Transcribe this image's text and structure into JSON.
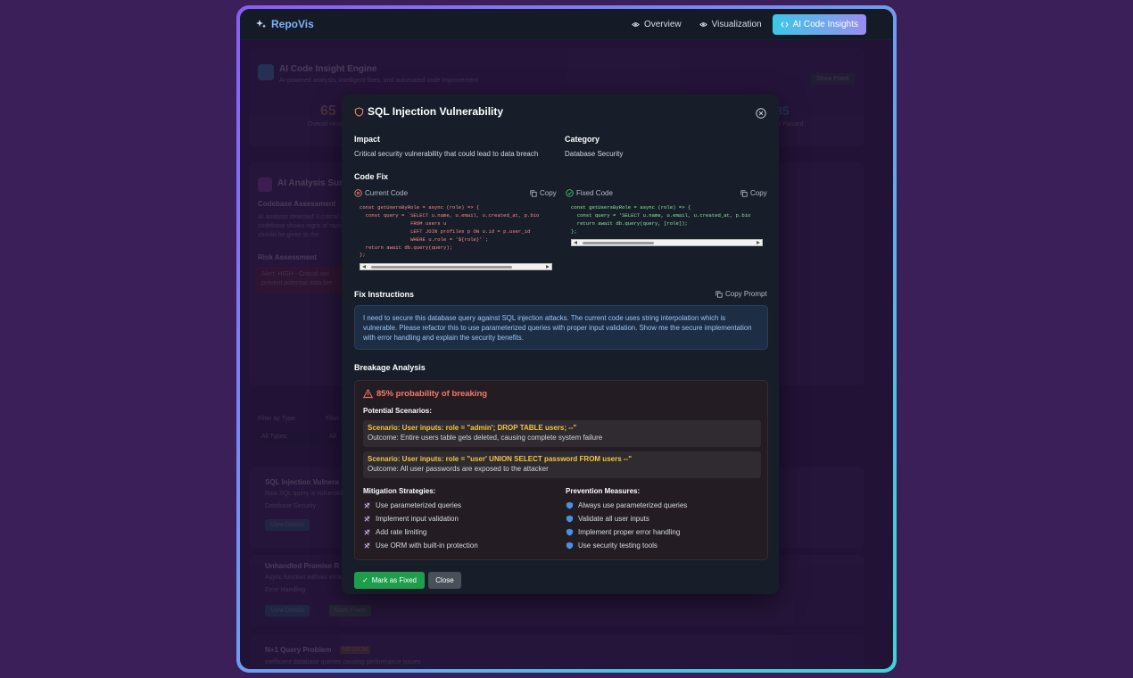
{
  "app": {
    "logo": "RepoVis"
  },
  "nav": [
    {
      "label": "Overview",
      "icon": "eye-icon"
    },
    {
      "label": "Visualization",
      "icon": "eye-icon"
    },
    {
      "label": "AI Code Insights",
      "icon": "code-icon",
      "active": true
    }
  ],
  "modal": {
    "title": "SQL Injection Vulnerability",
    "impact_label": "Impact",
    "impact_value": "Critical security vulnerability that could lead to data breach",
    "category_label": "Category",
    "category_value": "Database Security",
    "code_fix_label": "Code Fix",
    "current_code_label": "Current Code",
    "fixed_code_label": "Fixed Code",
    "copy_label": "Copy",
    "current_code": "const getUsersByRole = async (role) => {\n  const query = `SELECT u.name, u.email, u.created_at, p.bio\n                 FROM users u\n                 LEFT JOIN profiles p ON u.id = p.user_id\n                 WHERE u.role = '${role}'`;\n  return await db.query(query);\n};",
    "fixed_code": "const getUsersByRole = async (role) => {\n  const query = 'SELECT u.name, u.email, u.created_at, p.bio\n  return await db.query(query, [role]);\n};",
    "fix_instructions_label": "Fix Instructions",
    "copy_prompt_label": "Copy Prompt",
    "fix_instructions": "I need to secure this database query against SQL injection attacks. The current code uses string interpolation which is vulnerable. Please refactor this to use parameterized queries with proper input validation. Show me the secure implementation with error handling and explain the security benefits.",
    "breakage_label": "Breakage Analysis",
    "probability": "85% probability of breaking",
    "scenarios_label": "Potential Scenarios:",
    "scenarios": [
      {
        "title": "Scenario: User inputs: role = \"admin'; DROP TABLE users; --\"",
        "outcome": "Outcome: Entire users table gets deleted, causing complete system failure"
      },
      {
        "title": "Scenario: User inputs: role = \"user' UNION SELECT password FROM users --\"",
        "outcome": "Outcome: All user passwords are exposed to the attacker"
      }
    ],
    "mitigation_label": "Mitigation Strategies:",
    "mitigation": [
      "Use parameterized queries",
      "Implement input validation",
      "Add rate limiting",
      "Use ORM with built-in protection"
    ],
    "prevention_label": "Prevention Measures:",
    "prevention": [
      "Always use parameterized queries",
      "Validate all user inputs",
      "Implement proper error handling",
      "Use security testing tools"
    ],
    "mark_fixed_label": "Mark as Fixed",
    "close_label": "Close"
  },
  "background": {
    "engine_title": "AI Code Insight Engine",
    "engine_subtitle": "AI-powered analysis, intelligent fixes, and automated code improvement",
    "score": "65",
    "score_caption": "Overall Health",
    "right_stat": "85",
    "right_caption": "Tests Passed",
    "show_fixed": "Show Fixed",
    "analysis_title": "AI Analysis Summary",
    "codebase_heading": "Codebase Assessment",
    "codebase_lines": [
      "AI analysis detected 3 critical issues",
      "codebase shows signs of rapid",
      "should be given to the"
    ],
    "risk_heading": "Risk Assessment",
    "risk_lines": [
      "Alert: HIGH - Critical sec",
      "prevent potential data bre"
    ],
    "filter_type_label": "Filter by Type",
    "filter_type_value": "All Types",
    "filter_other_label": "Filter",
    "filter_other_value": "All",
    "issues": [
      {
        "title": "SQL Injection Vulnera",
        "desc": "Raw SQL query is vulnerable",
        "meta": "Database Security",
        "btn1": "View Details",
        "btn2": ""
      },
      {
        "title": "Unhandled Promise R",
        "desc": "Async function without error",
        "meta": "Error Handling",
        "btn1": "View Details",
        "btn2": "Mark Fixed"
      },
      {
        "title": "N+1 Query Problem",
        "desc": "Inefficient database queries causing performance issues",
        "meta": "",
        "tag": "MEDIUM",
        "btn1": "",
        "btn2": ""
      }
    ]
  },
  "colors": {
    "accent_gradient_start": "#3cc7e6",
    "accent_gradient_end": "#9a8cf2",
    "danger": "#f47b6b",
    "warning": "#f5c542",
    "success": "#1e9e4a"
  }
}
